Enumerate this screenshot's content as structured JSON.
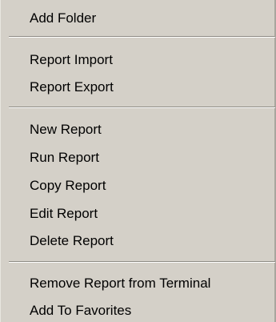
{
  "menu": {
    "groups": [
      {
        "items": [
          "Add Folder"
        ]
      },
      {
        "items": [
          "Report Import",
          "Report Export"
        ]
      },
      {
        "items": [
          "New Report",
          "Run Report",
          "Copy Report",
          "Edit Report",
          "Delete Report"
        ]
      },
      {
        "items": [
          "Remove Report from Terminal",
          "Add To Favorites"
        ]
      }
    ]
  }
}
